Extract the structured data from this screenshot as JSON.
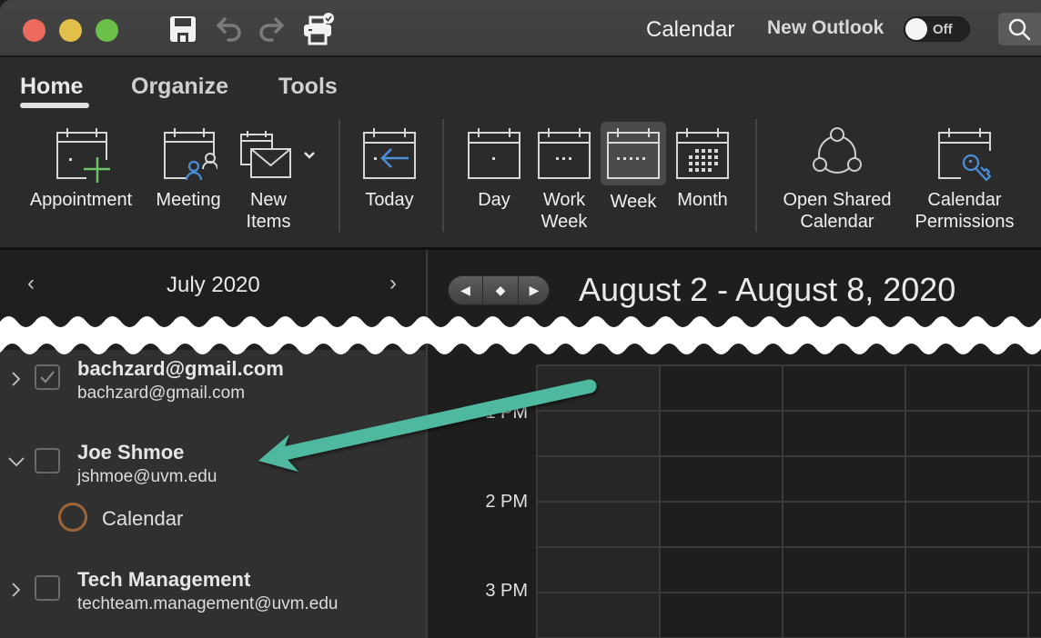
{
  "titlebar": {
    "window_controls": [
      "close",
      "minimize",
      "zoom"
    ],
    "toolbar_icons": [
      "save-icon",
      "undo-icon",
      "redo-icon",
      "print-icon"
    ],
    "title": "Calendar",
    "new_outlook_label": "New Outlook",
    "new_outlook_toggle": "Off",
    "search_icon": "search-icon"
  },
  "ribbon": {
    "tabs": [
      {
        "label": "Home",
        "active": true
      },
      {
        "label": "Organize",
        "active": false
      },
      {
        "label": "Tools",
        "active": false
      }
    ],
    "buttons": {
      "appointment": {
        "label": "Appointment",
        "icon": "calendar-add-icon"
      },
      "meeting": {
        "label": "Meeting",
        "icon": "calendar-people-icon"
      },
      "new_items": {
        "line1": "New",
        "line2": "Items",
        "icon": "calendar-mail-icon",
        "has_dropdown": true
      },
      "today": {
        "label": "Today",
        "icon": "calendar-back-arrow-icon"
      },
      "day": {
        "label": "Day",
        "icon": "calendar-day-icon"
      },
      "work_week": {
        "line1": "Work",
        "line2": "Week",
        "icon": "calendar-workweek-icon"
      },
      "week": {
        "label": "Week",
        "icon": "calendar-week-icon",
        "selected": true
      },
      "month": {
        "label": "Month",
        "icon": "calendar-month-icon"
      },
      "open_shared": {
        "line1": "Open Shared",
        "line2": "Calendar",
        "icon": "share-network-icon"
      },
      "permissions": {
        "line1": "Calendar",
        "line2": "Permissions",
        "icon": "calendar-key-icon"
      }
    },
    "accent_green": "#6cc36a",
    "accent_blue": "#4a90d9"
  },
  "mini_calendar": {
    "month_title": "July 2020",
    "prev": "‹",
    "next": "›"
  },
  "accounts": [
    {
      "name": "bachzard@gmail.com",
      "email": "bachzard@gmail.com",
      "expanded": false,
      "checked": true
    },
    {
      "name": "Joe Shmoe",
      "email": "jshmoe@uvm.edu",
      "expanded": true,
      "checked": false,
      "calendars": [
        {
          "label": "Calendar",
          "color": "#9c6437"
        }
      ]
    },
    {
      "name": "Tech Management",
      "email": "techteam.management@uvm.edu",
      "expanded": false,
      "checked": false
    }
  ],
  "calendar_view": {
    "date_range": "August 2 - August 8, 2020",
    "nav": {
      "prev": "◀",
      "today": "◆",
      "next": "▶"
    },
    "time_labels": [
      "1 PM",
      "2 PM",
      "3 PM"
    ]
  },
  "annotation": {
    "arrow_color": "#4fb9a0"
  }
}
